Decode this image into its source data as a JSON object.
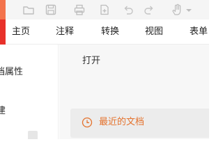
{
  "toolbar": {
    "accent_color": "#f3734c",
    "icons": [
      "open-folder-icon",
      "save-icon",
      "print-icon",
      "new-document-icon",
      "undo-icon",
      "redo-icon",
      "hand-tool-icon",
      "dropdown-arrow-icon"
    ]
  },
  "ribbon": {
    "tabs": [
      {
        "label": "主页"
      },
      {
        "label": "注释"
      },
      {
        "label": "转换"
      },
      {
        "label": "视图"
      },
      {
        "label": "表单"
      }
    ]
  },
  "sidebar": {
    "items": [
      {
        "label": "档属性"
      },
      {
        "label": "建"
      }
    ]
  },
  "main": {
    "open_label": "打开",
    "recent_label": "最近的文档",
    "recent_color": "#e4722d"
  }
}
